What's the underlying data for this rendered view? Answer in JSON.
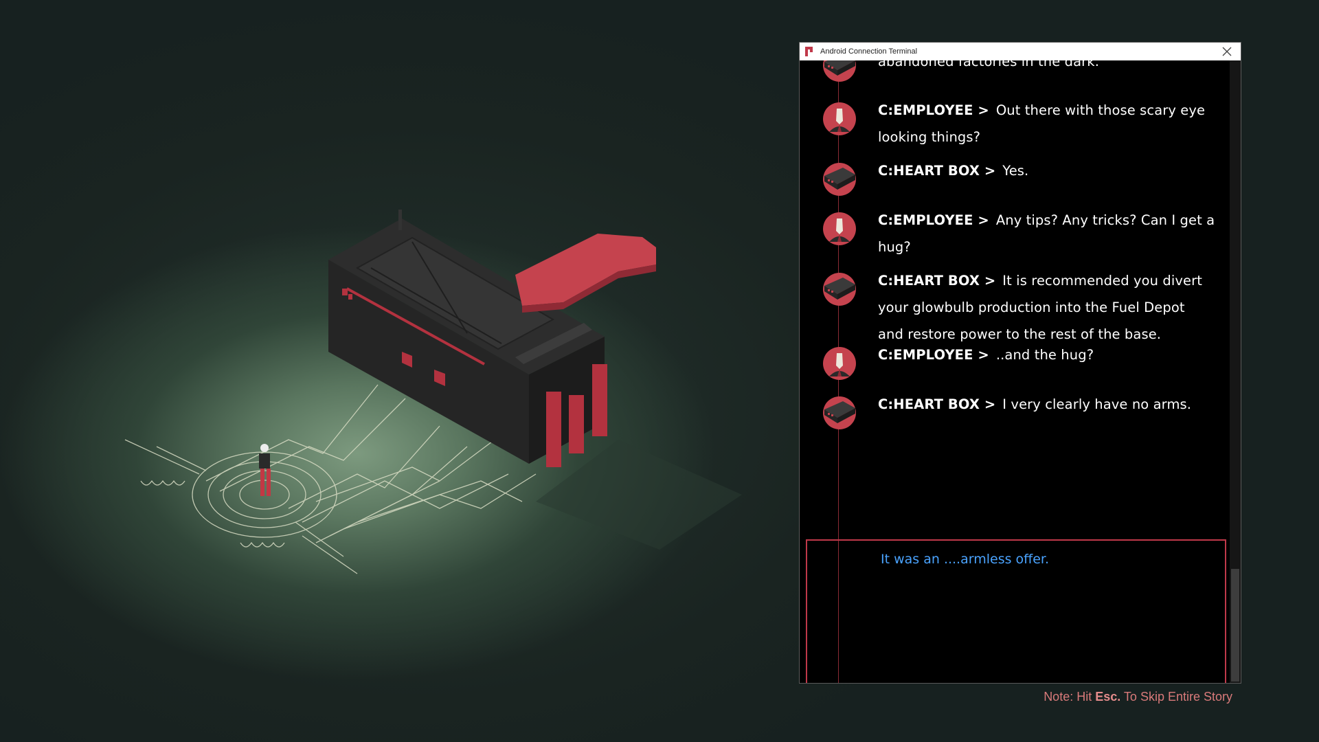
{
  "window": {
    "title": "Android Connection Terminal",
    "close_icon": "close-icon"
  },
  "messages": [
    {
      "speaker": "",
      "avatar": "heart-box",
      "lines": [
        "abandoned factories in the dark."
      ]
    },
    {
      "speaker": "C:EMPLOYEE >",
      "avatar": "employee",
      "text": "Out there with those scary eye looking things?"
    },
    {
      "speaker": "C:HEART BOX >",
      "avatar": "heart-box",
      "text": "Yes."
    },
    {
      "speaker": "C:EMPLOYEE >",
      "avatar": "employee",
      "text": "Any tips? Any tricks? Can I get a hug?"
    },
    {
      "speaker": "C:HEART BOX >",
      "avatar": "heart-box",
      "text": "It is recommended you divert your glowbulb production into the Fuel Depot",
      "text2": "and restore power to the rest of the base."
    },
    {
      "speaker": "C:EMPLOYEE >",
      "avatar": "employee",
      "text": "..and the hug?"
    },
    {
      "speaker": "C:HEART BOX >",
      "avatar": "heart-box",
      "text": "I very clearly have no arms."
    }
  ],
  "choice": {
    "text": "It was an ....armless offer."
  },
  "note": {
    "prefix": "Note: Hit ",
    "key": "Esc.",
    "suffix": " To Skip Entire Story"
  },
  "colors": {
    "accent_red": "#c0394a",
    "choice_blue": "#4aa3ff",
    "note": "#d97a7a"
  }
}
